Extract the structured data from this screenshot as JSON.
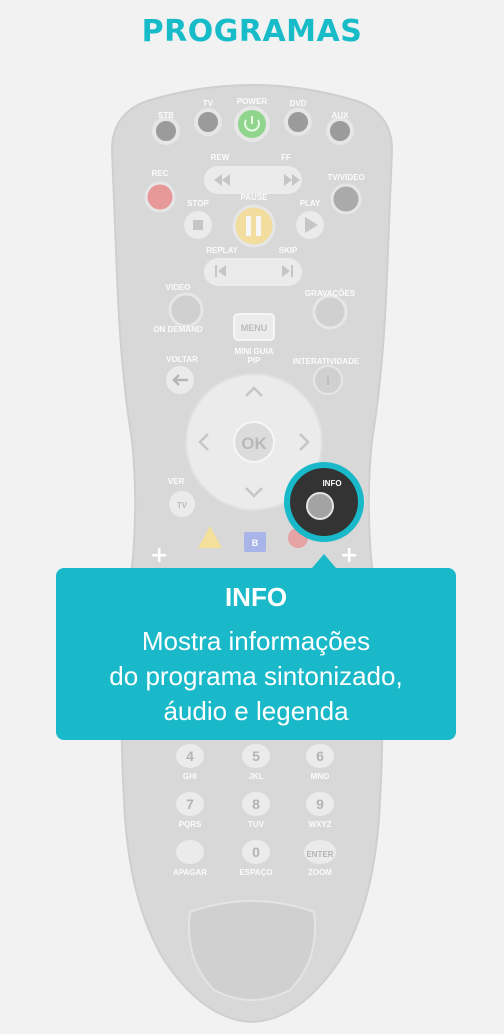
{
  "page": {
    "title": "PROGRAMAS"
  },
  "remote": {
    "labels": {
      "stb": "STB",
      "tv": "TV",
      "power": "POWER",
      "dvd": "DVD",
      "aux": "AUX",
      "rew": "REW",
      "ff": "FF",
      "rec": "REC",
      "tvvideo": "TV/VIDEO",
      "stop": "STOP",
      "pause": "PAUSE",
      "play": "PLAY",
      "replay": "REPLAY",
      "skip": "SKIP",
      "video": "VIDEO",
      "on_demand": "ON DEMAND",
      "gravacoes": "GRAVAÇÕES",
      "menu": "MENU",
      "mini_guia": "MINI GUIA",
      "pip": "PIP",
      "voltar": "VOLTAR",
      "interatividade": "INTERATIVIDADE",
      "ok": "OK",
      "ver": "VER",
      "tv_small": "TV",
      "info": "INFO",
      "b": "B",
      "plus": "+"
    },
    "keypad": [
      {
        "num": "4",
        "sub": "GHI"
      },
      {
        "num": "5",
        "sub": "JKL"
      },
      {
        "num": "6",
        "sub": "MNO"
      },
      {
        "num": "7",
        "sub": "PQRS"
      },
      {
        "num": "8",
        "sub": "TUV"
      },
      {
        "num": "9",
        "sub": "WXYZ"
      },
      {
        "num": "",
        "sub": "APAGAR"
      },
      {
        "num": "0",
        "sub": "ESPAÇO"
      },
      {
        "num": "ENTER",
        "sub": "ZOOM"
      }
    ]
  },
  "callout": {
    "title": "INFO",
    "description": "Mostra informações\ndo programa sintonizado,\náudio e legenda"
  },
  "colors": {
    "accent": "#1ab9c9",
    "title": "#17bcc8",
    "remote_body": "#d7d7d7",
    "button": "#ebebeb"
  }
}
